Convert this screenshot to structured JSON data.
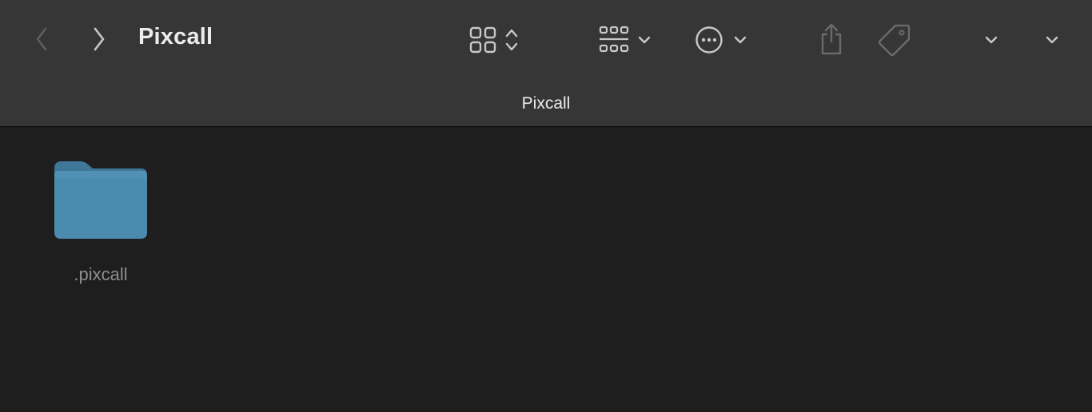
{
  "window": {
    "title": "Pixcall"
  },
  "toolbar": {
    "back_icon": "chevron-left-icon",
    "forward_icon": "chevron-right-icon",
    "view_icon": "grid-view-icon",
    "group_icon": "group-by-icon",
    "action_icon": "ellipsis-circle-icon",
    "share_icon": "share-icon",
    "tag_icon": "tag-icon"
  },
  "pathbar": {
    "title": "Pixcall"
  },
  "files": [
    {
      "name": ".pixcall",
      "kind": "folder",
      "icon": "folder-icon",
      "color": "#4b8bb0"
    }
  ],
  "colors": {
    "toolbar_bg": "#363636",
    "content_bg": "#1e1e1e",
    "folder": "#4b8bb0",
    "label_hidden": "#8e8e8e"
  }
}
